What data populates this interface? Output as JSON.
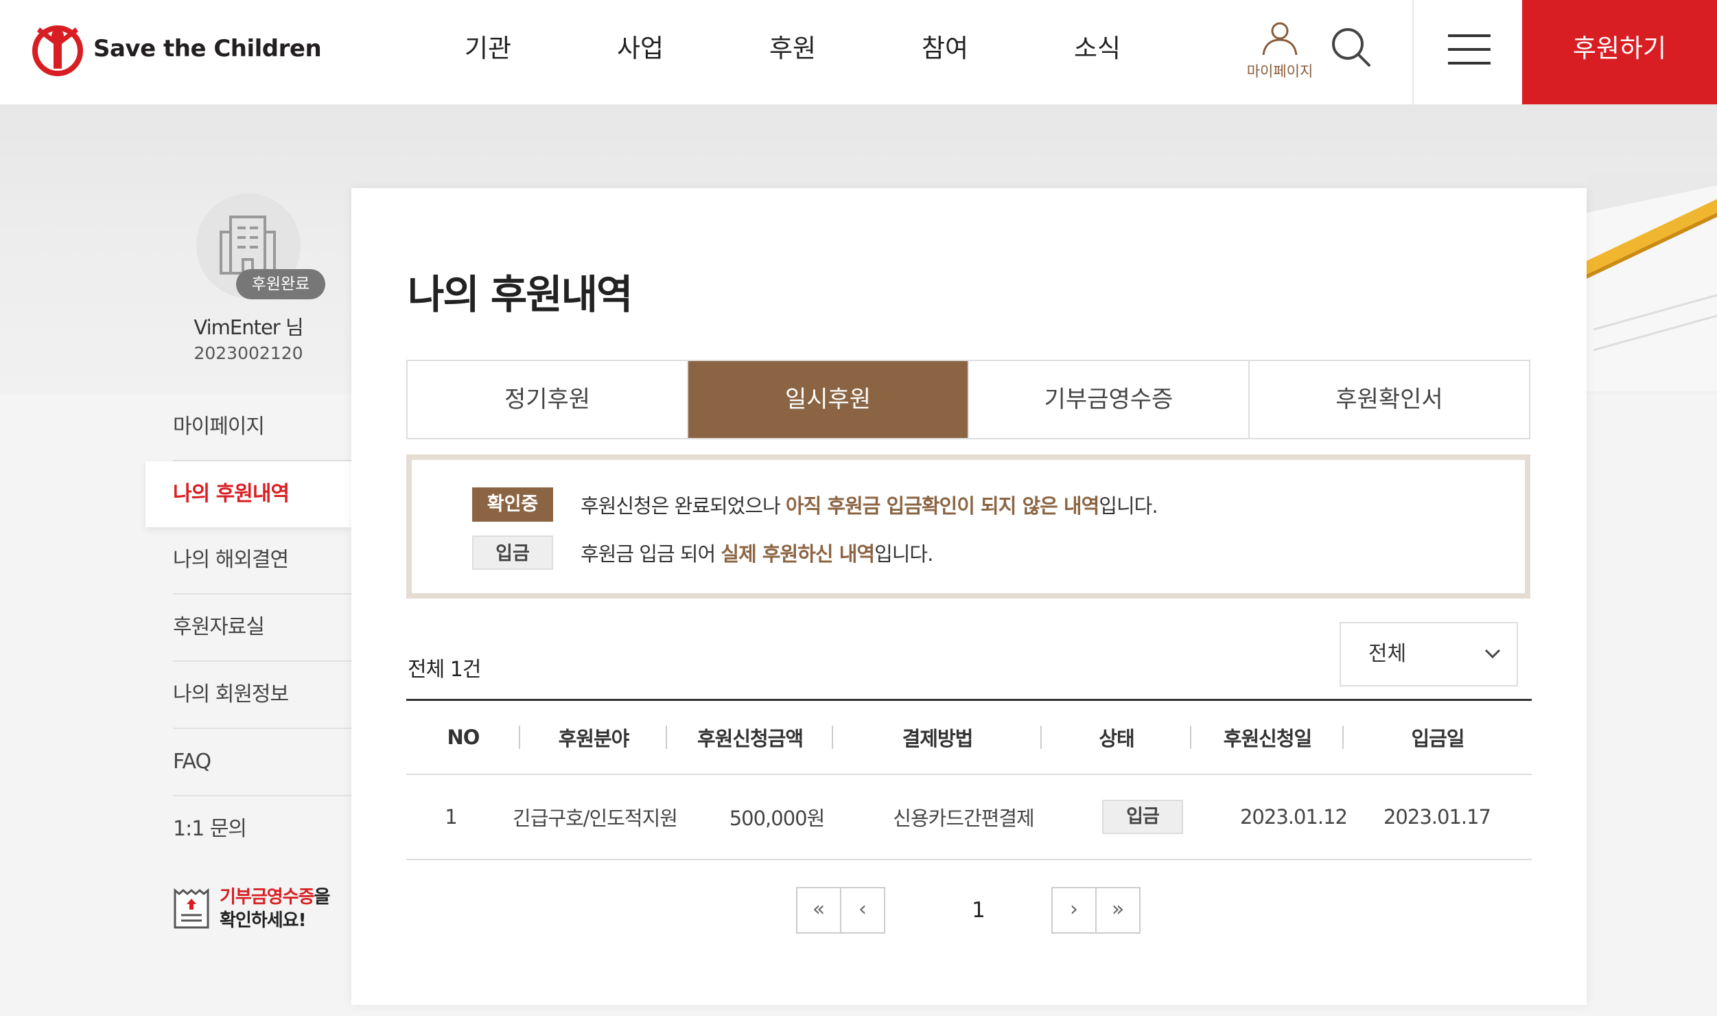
{
  "header": {
    "logo_text": "Save the Children",
    "nav": [
      "기관",
      "사업",
      "후원",
      "참여",
      "소식"
    ],
    "mypage_label": "마이페이지",
    "cta_label": "후원하기"
  },
  "profile": {
    "badge": "후원완료",
    "name": "VimEnter 님",
    "id": "2023002120"
  },
  "sidebar": {
    "items": [
      {
        "label": "마이페이지"
      },
      {
        "label": "나의 후원내역"
      },
      {
        "label": "나의 해외결연"
      },
      {
        "label": "후원자료실"
      },
      {
        "label": "나의 회원정보"
      },
      {
        "label": "FAQ"
      },
      {
        "label": "1:1 문의"
      }
    ],
    "receipt_red": "기부금영수증",
    "receipt_tail": "을",
    "receipt_line2": "확인하세요!"
  },
  "main": {
    "title": "나의 후원내역",
    "tabs": [
      "정기후원",
      "일시후원",
      "기부금영수증",
      "후원확인서"
    ],
    "active_tab": "일시후원",
    "notice": {
      "row1": {
        "tag": "확인중",
        "text_a": "후원신청은 완료되었으나 ",
        "text_b": "아직 후원금 입금확인이 되지 않은 내역",
        "text_c": "입니다."
      },
      "row2": {
        "tag": "입금",
        "text_a": "후원금 입금 되어 ",
        "text_b": "실제 후원하신 내역",
        "text_c": "입니다."
      }
    },
    "total_label": "전체 1건",
    "filter_value": "전체",
    "table": {
      "headers": [
        "NO",
        "후원분야",
        "후원신청금액",
        "결제방법",
        "상태",
        "후원신청일",
        "입금일"
      ],
      "rows": [
        [
          "1",
          "긴급구호/인도적지원",
          "500,000원",
          "신용카드간편결제",
          "입금",
          "2023.01.12",
          "2023.01.17"
        ]
      ]
    },
    "pager": {
      "current_page": "1",
      "first": "«",
      "prev": "‹",
      "next": "›",
      "last": "»"
    }
  },
  "colors": {
    "brand_red": "#d81e22",
    "brown_accent": "#8b6543"
  }
}
